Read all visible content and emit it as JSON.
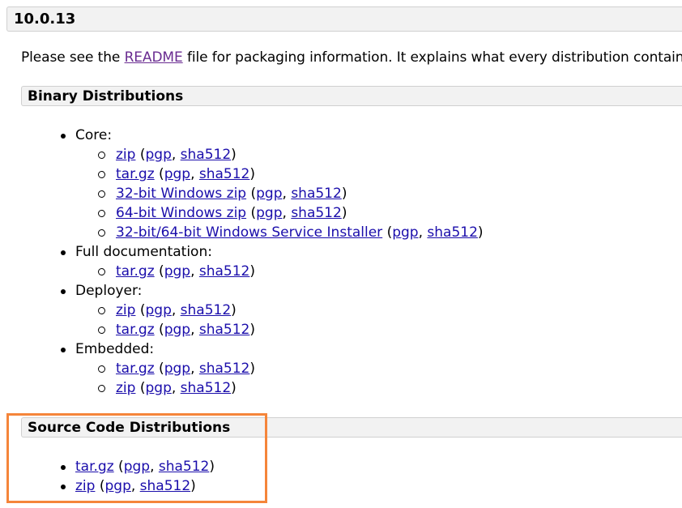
{
  "version_header": "10.0.13",
  "intro": {
    "before": "Please see the ",
    "link": "README",
    "after": " file for packaging information. It explains what every distribution contains."
  },
  "binary": {
    "title": "Binary Distributions",
    "groups": [
      {
        "label": "Core:",
        "items": [
          {
            "name": "zip",
            "pgp": "pgp",
            "sha": "sha512"
          },
          {
            "name": "tar.gz",
            "pgp": "pgp",
            "sha": "sha512"
          },
          {
            "name": "32-bit Windows zip",
            "pgp": "pgp",
            "sha": "sha512"
          },
          {
            "name": "64-bit Windows zip",
            "pgp": "pgp",
            "sha": "sha512"
          },
          {
            "name": "32-bit/64-bit Windows Service Installer",
            "pgp": "pgp",
            "sha": "sha512"
          }
        ]
      },
      {
        "label": "Full documentation:",
        "items": [
          {
            "name": "tar.gz",
            "pgp": "pgp",
            "sha": "sha512"
          }
        ]
      },
      {
        "label": "Deployer:",
        "items": [
          {
            "name": "zip",
            "pgp": "pgp",
            "sha": "sha512"
          },
          {
            "name": "tar.gz",
            "pgp": "pgp",
            "sha": "sha512"
          }
        ]
      },
      {
        "label": "Embedded:",
        "items": [
          {
            "name": "tar.gz",
            "pgp": "pgp",
            "sha": "sha512"
          },
          {
            "name": "zip",
            "pgp": "pgp",
            "sha": "sha512"
          }
        ]
      }
    ]
  },
  "source": {
    "title": "Source Code Distributions",
    "items": [
      {
        "name": "tar.gz",
        "pgp": "pgp",
        "sha": "sha512"
      },
      {
        "name": "zip",
        "pgp": "pgp",
        "sha": "sha512"
      }
    ]
  },
  "punct": {
    "open": " (",
    "comma": ", ",
    "close": ")"
  },
  "colors": {
    "link": "#1a0dab",
    "visited_link": "#6a2c91",
    "highlight": "#f5853a",
    "header_bg": "#f2f2f2"
  }
}
